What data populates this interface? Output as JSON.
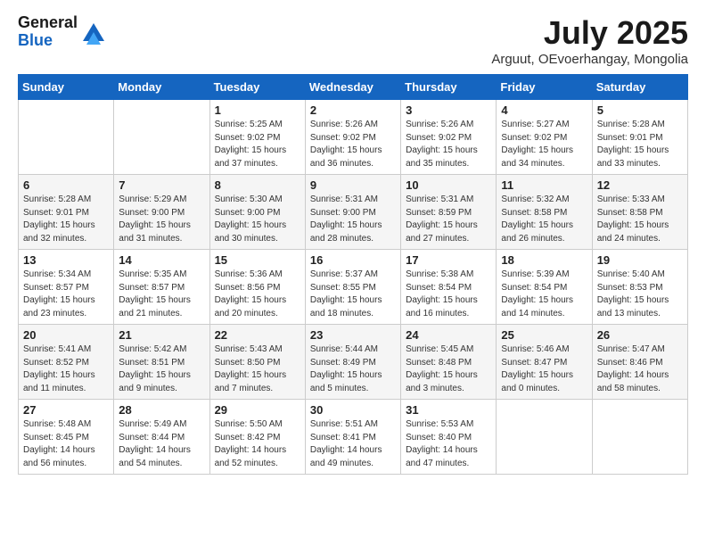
{
  "header": {
    "logo_line1": "General",
    "logo_line2": "Blue",
    "month_title": "July 2025",
    "subtitle": "Arguut, OEvoerhangay, Mongolia"
  },
  "days_of_week": [
    "Sunday",
    "Monday",
    "Tuesday",
    "Wednesday",
    "Thursday",
    "Friday",
    "Saturday"
  ],
  "weeks": [
    [
      {
        "day": "",
        "info": ""
      },
      {
        "day": "",
        "info": ""
      },
      {
        "day": "1",
        "info": "Sunrise: 5:25 AM\nSunset: 9:02 PM\nDaylight: 15 hours and 37 minutes."
      },
      {
        "day": "2",
        "info": "Sunrise: 5:26 AM\nSunset: 9:02 PM\nDaylight: 15 hours and 36 minutes."
      },
      {
        "day": "3",
        "info": "Sunrise: 5:26 AM\nSunset: 9:02 PM\nDaylight: 15 hours and 35 minutes."
      },
      {
        "day": "4",
        "info": "Sunrise: 5:27 AM\nSunset: 9:02 PM\nDaylight: 15 hours and 34 minutes."
      },
      {
        "day": "5",
        "info": "Sunrise: 5:28 AM\nSunset: 9:01 PM\nDaylight: 15 hours and 33 minutes."
      }
    ],
    [
      {
        "day": "6",
        "info": "Sunrise: 5:28 AM\nSunset: 9:01 PM\nDaylight: 15 hours and 32 minutes."
      },
      {
        "day": "7",
        "info": "Sunrise: 5:29 AM\nSunset: 9:00 PM\nDaylight: 15 hours and 31 minutes."
      },
      {
        "day": "8",
        "info": "Sunrise: 5:30 AM\nSunset: 9:00 PM\nDaylight: 15 hours and 30 minutes."
      },
      {
        "day": "9",
        "info": "Sunrise: 5:31 AM\nSunset: 9:00 PM\nDaylight: 15 hours and 28 minutes."
      },
      {
        "day": "10",
        "info": "Sunrise: 5:31 AM\nSunset: 8:59 PM\nDaylight: 15 hours and 27 minutes."
      },
      {
        "day": "11",
        "info": "Sunrise: 5:32 AM\nSunset: 8:58 PM\nDaylight: 15 hours and 26 minutes."
      },
      {
        "day": "12",
        "info": "Sunrise: 5:33 AM\nSunset: 8:58 PM\nDaylight: 15 hours and 24 minutes."
      }
    ],
    [
      {
        "day": "13",
        "info": "Sunrise: 5:34 AM\nSunset: 8:57 PM\nDaylight: 15 hours and 23 minutes."
      },
      {
        "day": "14",
        "info": "Sunrise: 5:35 AM\nSunset: 8:57 PM\nDaylight: 15 hours and 21 minutes."
      },
      {
        "day": "15",
        "info": "Sunrise: 5:36 AM\nSunset: 8:56 PM\nDaylight: 15 hours and 20 minutes."
      },
      {
        "day": "16",
        "info": "Sunrise: 5:37 AM\nSunset: 8:55 PM\nDaylight: 15 hours and 18 minutes."
      },
      {
        "day": "17",
        "info": "Sunrise: 5:38 AM\nSunset: 8:54 PM\nDaylight: 15 hours and 16 minutes."
      },
      {
        "day": "18",
        "info": "Sunrise: 5:39 AM\nSunset: 8:54 PM\nDaylight: 15 hours and 14 minutes."
      },
      {
        "day": "19",
        "info": "Sunrise: 5:40 AM\nSunset: 8:53 PM\nDaylight: 15 hours and 13 minutes."
      }
    ],
    [
      {
        "day": "20",
        "info": "Sunrise: 5:41 AM\nSunset: 8:52 PM\nDaylight: 15 hours and 11 minutes."
      },
      {
        "day": "21",
        "info": "Sunrise: 5:42 AM\nSunset: 8:51 PM\nDaylight: 15 hours and 9 minutes."
      },
      {
        "day": "22",
        "info": "Sunrise: 5:43 AM\nSunset: 8:50 PM\nDaylight: 15 hours and 7 minutes."
      },
      {
        "day": "23",
        "info": "Sunrise: 5:44 AM\nSunset: 8:49 PM\nDaylight: 15 hours and 5 minutes."
      },
      {
        "day": "24",
        "info": "Sunrise: 5:45 AM\nSunset: 8:48 PM\nDaylight: 15 hours and 3 minutes."
      },
      {
        "day": "25",
        "info": "Sunrise: 5:46 AM\nSunset: 8:47 PM\nDaylight: 15 hours and 0 minutes."
      },
      {
        "day": "26",
        "info": "Sunrise: 5:47 AM\nSunset: 8:46 PM\nDaylight: 14 hours and 58 minutes."
      }
    ],
    [
      {
        "day": "27",
        "info": "Sunrise: 5:48 AM\nSunset: 8:45 PM\nDaylight: 14 hours and 56 minutes."
      },
      {
        "day": "28",
        "info": "Sunrise: 5:49 AM\nSunset: 8:44 PM\nDaylight: 14 hours and 54 minutes."
      },
      {
        "day": "29",
        "info": "Sunrise: 5:50 AM\nSunset: 8:42 PM\nDaylight: 14 hours and 52 minutes."
      },
      {
        "day": "30",
        "info": "Sunrise: 5:51 AM\nSunset: 8:41 PM\nDaylight: 14 hours and 49 minutes."
      },
      {
        "day": "31",
        "info": "Sunrise: 5:53 AM\nSunset: 8:40 PM\nDaylight: 14 hours and 47 minutes."
      },
      {
        "day": "",
        "info": ""
      },
      {
        "day": "",
        "info": ""
      }
    ]
  ]
}
